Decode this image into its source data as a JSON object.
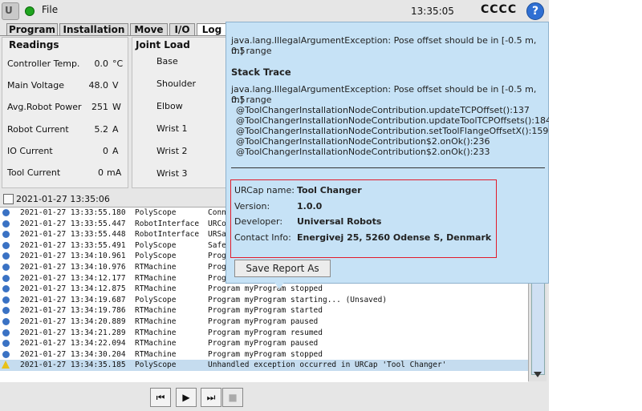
{
  "topbar": {
    "logo_text": "U",
    "file_menu": "File",
    "clock": "13:35:05",
    "robot_name": "CCCC",
    "help_symbol": "?"
  },
  "tabs": [
    "Program",
    "Installation",
    "Move",
    "I/O",
    "Log"
  ],
  "readings": {
    "title": "Readings",
    "rows": [
      {
        "label": "Controller Temp.",
        "value": "0.0",
        "unit": "°C"
      },
      {
        "label": "Main Voltage",
        "value": "48.0",
        "unit": "V"
      },
      {
        "label": "Avg.Robot Power",
        "value": "251",
        "unit": "W"
      },
      {
        "label": "Robot Current",
        "value": "5.2",
        "unit": "A"
      },
      {
        "label": "IO Current",
        "value": "0",
        "unit": "A"
      },
      {
        "label": "Tool Current",
        "value": "0",
        "unit": "mA"
      }
    ]
  },
  "joint_load": {
    "title": "Joint Load",
    "items": [
      "Base",
      "Shoulder",
      "Elbow",
      "Wrist 1",
      "Wrist 2",
      "Wrist 3"
    ]
  },
  "timestamp": "2021-01-27 13:35:06",
  "log": [
    {
      "dt": "2021-01-27 13:33:55.180",
      "src": "PolyScope",
      "msg": "Conn"
    },
    {
      "dt": "2021-01-27 13:33:55.447",
      "src": "RobotInterface",
      "msg": "URCo"
    },
    {
      "dt": "2021-01-27 13:33:55.448",
      "src": "RobotInterface",
      "msg": "URSa"
    },
    {
      "dt": "2021-01-27 13:33:55.491",
      "src": "PolyScope",
      "msg": "Safe"
    },
    {
      "dt": "2021-01-27 13:34:10.961",
      "src": "PolyScope",
      "msg": "Prog"
    },
    {
      "dt": "2021-01-27 13:34:10.976",
      "src": "RTMachine",
      "msg": "Prog"
    },
    {
      "dt": "2021-01-27 13:34:12.177",
      "src": "RTMachine",
      "msg": "Prog"
    },
    {
      "dt": "2021-01-27 13:34:12.875",
      "src": "RTMachine",
      "msg": "Program myProgram stopped"
    },
    {
      "dt": "2021-01-27 13:34:19.687",
      "src": "PolyScope",
      "msg": "Program myProgram starting... (Unsaved)"
    },
    {
      "dt": "2021-01-27 13:34:19.786",
      "src": "RTMachine",
      "msg": "Program myProgram started"
    },
    {
      "dt": "2021-01-27 13:34:20.889",
      "src": "RTMachine",
      "msg": "Program myProgram paused"
    },
    {
      "dt": "2021-01-27 13:34:21.289",
      "src": "RTMachine",
      "msg": "Program myProgram resumed"
    },
    {
      "dt": "2021-01-27 13:34:22.094",
      "src": "RTMachine",
      "msg": "Program myProgram paused"
    },
    {
      "dt": "2021-01-27 13:34:30.204",
      "src": "RTMachine",
      "msg": "Program myProgram stopped"
    },
    {
      "dt": "2021-01-27 13:34:35.185",
      "src": "PolyScope",
      "msg": "Unhandled exception occurred in URCap 'Tool Changer'",
      "level": "warning"
    }
  ],
  "controls": {
    "rewind": "⏮",
    "play": "▶",
    "step": "⏭",
    "stop": "■"
  },
  "popup": {
    "exception_line1": "java.lang.IllegalArgumentException: Pose offset should be in [-0.5 m, 0.5",
    "exception_line2": "m] range",
    "stack_title": "Stack Trace",
    "stack_line1": "java.lang.IllegalArgumentException: Pose offset should be in [-0.5 m, 0.5",
    "stack_line2": "m] range",
    "frames": [
      "@ToolChangerInstallationNodeContribution.updateTCPOffset():137",
      "@ToolChangerInstallationNodeContribution.updateToolTCPOffsets():184",
      "@ToolChangerInstallationNodeContribution.setToolFlangeOffsetX():159",
      "@ToolChangerInstallationNodeContribution$2.onOk():236",
      "@ToolChangerInstallationNodeContribution$2.onOk():233"
    ],
    "info": [
      {
        "label": "URCap name:",
        "value": "Tool Changer"
      },
      {
        "label": "Version:",
        "value": "1.0.0"
      },
      {
        "label": "Developer:",
        "value": "Universal Robots"
      },
      {
        "label": "Contact Info:",
        "value": "Energivej 25, 5260 Odense S, Denmark"
      }
    ],
    "save_button": "Save Report As"
  },
  "colors": {
    "accent_red": "#e21b2a",
    "popup_bg": "#c6e2f6",
    "status_green": "#1fa51f",
    "help_blue": "#2f6fd3"
  }
}
